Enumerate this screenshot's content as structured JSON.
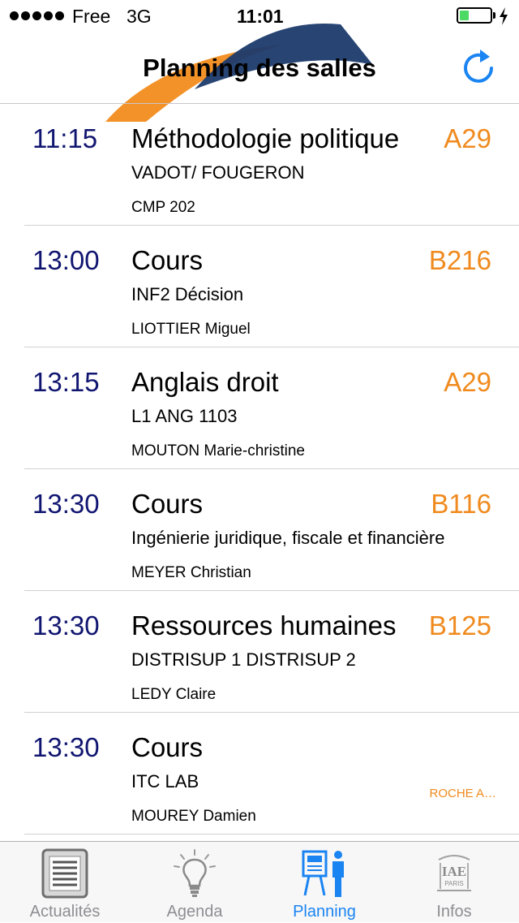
{
  "status_bar": {
    "carrier": "Free",
    "network": "3G",
    "time": "11:01",
    "battery_level": 0.3
  },
  "header": {
    "title": "Planning des salles",
    "refresh_icon": "refresh-icon",
    "accent_color": "#1a84f2"
  },
  "colors": {
    "time": "#101570",
    "room": "#f08a1e",
    "tab_active": "#1a84f2",
    "tab_inactive": "#8e8e93"
  },
  "schedule": [
    {
      "time": "11:15",
      "course": "Méthodologie politique",
      "room": "A29",
      "detail": "VADOT/ FOUGERON",
      "teacher": "CMP 202"
    },
    {
      "time": "13:00",
      "course": "Cours",
      "room": "B216",
      "detail": "INF2 Décision",
      "teacher": "LIOTTIER  Miguel"
    },
    {
      "time": "13:15",
      "course": "Anglais droit",
      "room": "A29",
      "detail": "L1 ANG 1103",
      "teacher": "MOUTON  Marie-christine"
    },
    {
      "time": "13:30",
      "course": "Cours",
      "room": "B116",
      "detail": "Ingénierie juridique, fiscale et financière",
      "teacher": "MEYER  Christian"
    },
    {
      "time": "13:30",
      "course": "Ressources humaines",
      "room": "B125",
      "detail": "DISTRISUP 1 DISTRISUP 2",
      "teacher": "LEDY  Claire"
    },
    {
      "time": "13:30",
      "course": "Cours",
      "room": "ROCHE A…",
      "detail": "ITC LAB",
      "teacher": "MOUREY  Damien"
    }
  ],
  "tabs": [
    {
      "label": "Actualités",
      "icon": "newspaper-icon",
      "active": false
    },
    {
      "label": "Agenda",
      "icon": "lightbulb-icon",
      "active": false
    },
    {
      "label": "Planning",
      "icon": "planning-board-icon",
      "active": true
    },
    {
      "label": "Infos",
      "icon": "iae-paris-logo-icon",
      "active": false
    }
  ]
}
